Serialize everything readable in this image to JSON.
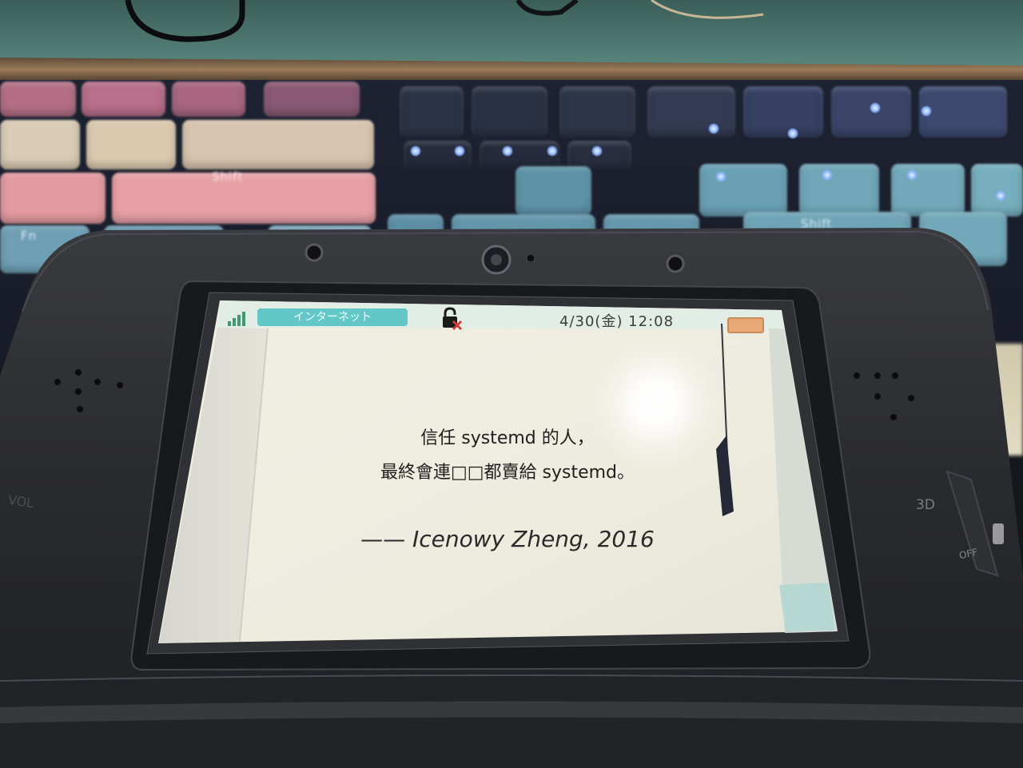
{
  "keyboard": {
    "keys": [
      {
        "label": "Shift"
      },
      {
        "label": "Fn"
      },
      {
        "label": "Shift"
      }
    ]
  },
  "device": {
    "vol_label": "VOL",
    "depth_label": "3D",
    "off_label": "OFF"
  },
  "status_bar": {
    "signal_icon": "signal-bars-icon",
    "app_label": "インターネット",
    "lock_icon": "lock-broken-icon",
    "datetime": "4/30(金) 12:08",
    "battery_icon": "battery-icon"
  },
  "page": {
    "quote_lines": [
      "信任 systemd 的人，",
      "最終會連□□都賣給 systemd。"
    ],
    "attribution": "—— Icenowy Zheng, 2016"
  },
  "colors": {
    "app_pill": "#63c7c8",
    "battery": "#e8a878",
    "lock_cross": "#d23a3a",
    "device_body": "#2a2b2e",
    "page_background": "#eeecdf"
  }
}
